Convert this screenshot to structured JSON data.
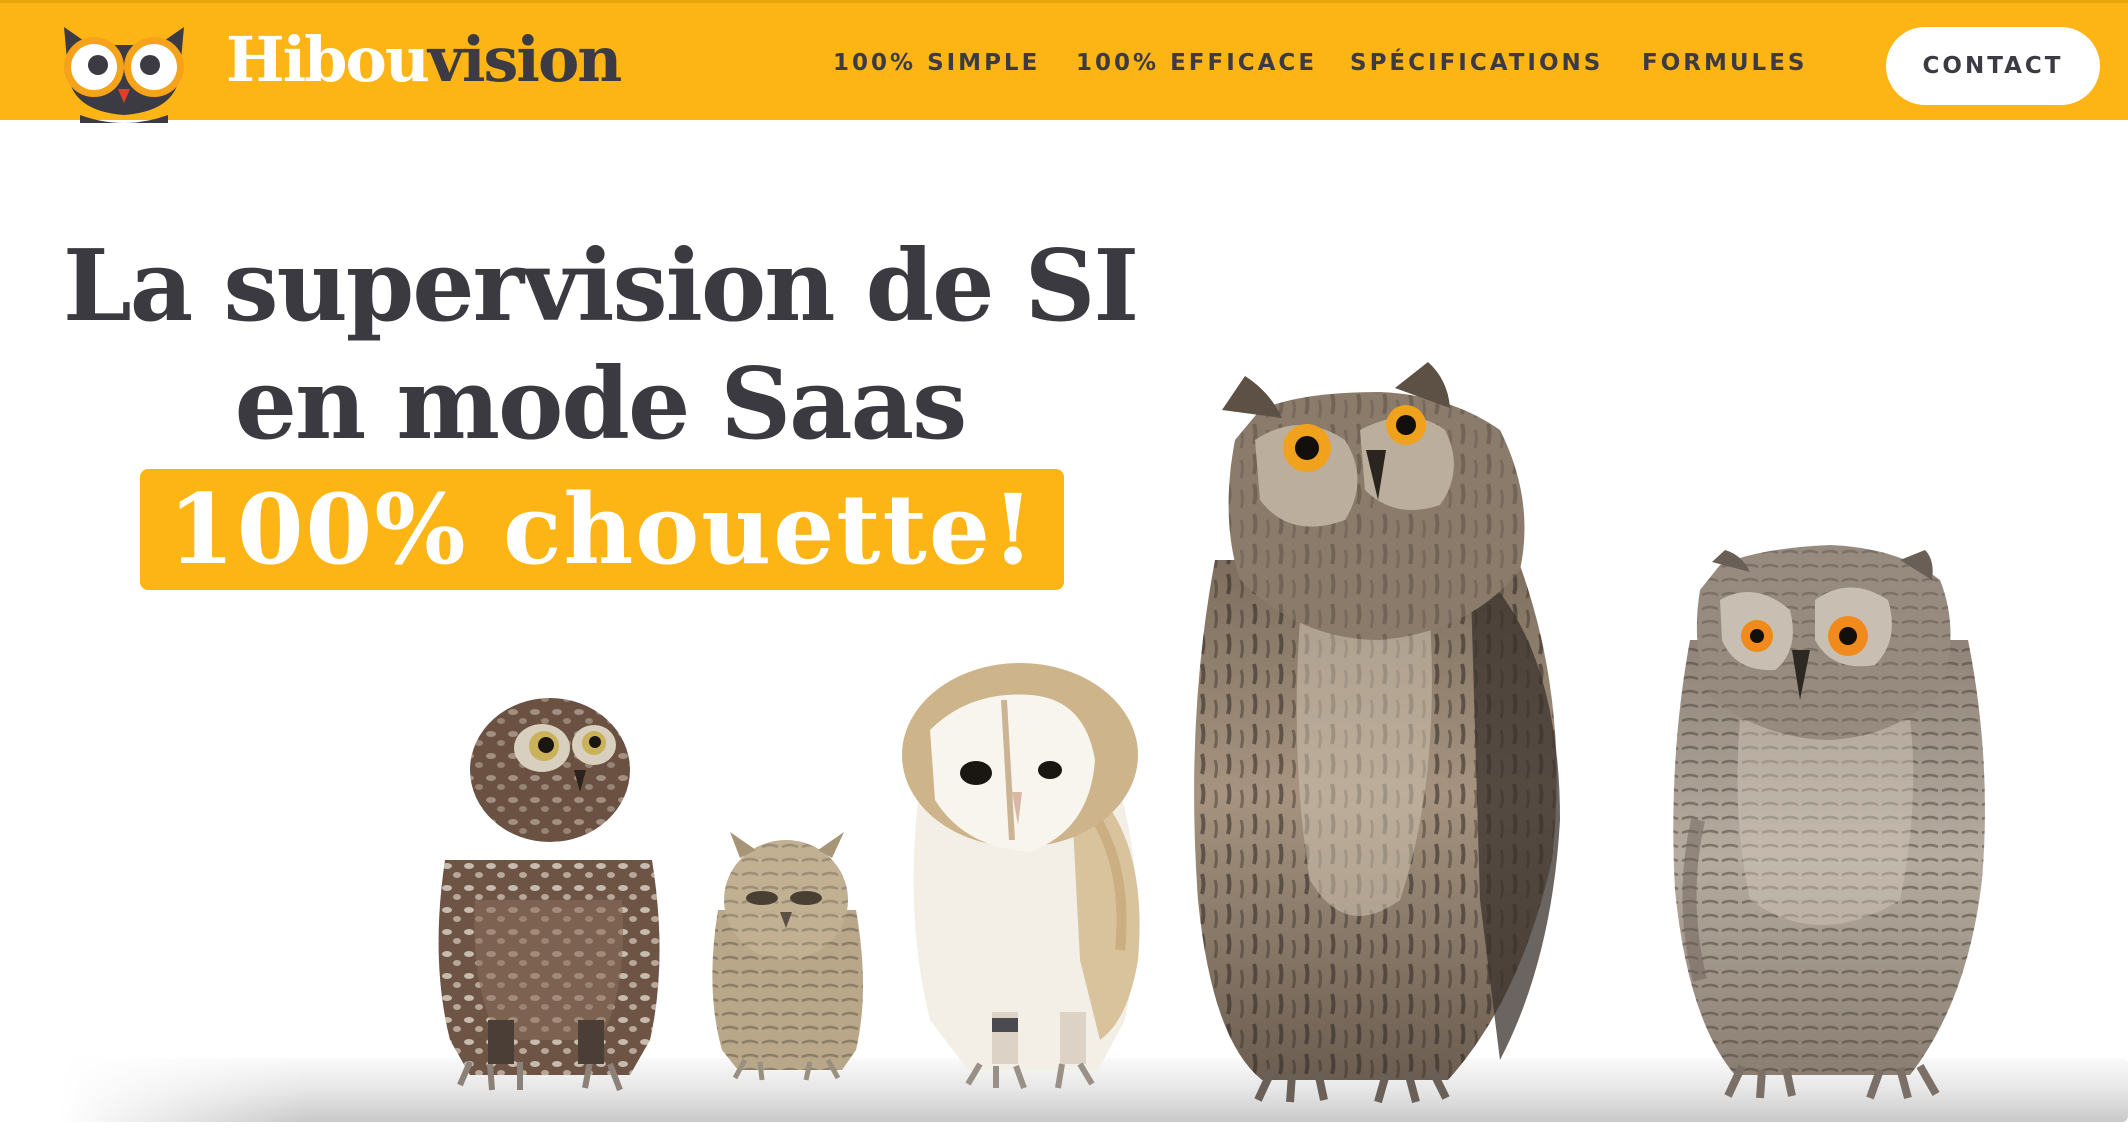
{
  "header": {
    "logo": {
      "text_part1": "Hibou",
      "text_part2": "vision",
      "icon": "owl-logo-icon"
    },
    "nav": [
      {
        "label": "100% SIMPLE"
      },
      {
        "label": "100% EFFICACE"
      },
      {
        "label": "SPÉCIFICATIONS"
      },
      {
        "label": "FORMULES"
      }
    ],
    "contact_label": "CONTACT"
  },
  "hero": {
    "title_line1": "La supervision de SI",
    "title_line2": "en mode Saas",
    "tagline": "100% chouette!"
  },
  "illustration": {
    "subject": "owls-on-perch"
  },
  "colors": {
    "brand": "#fdb515",
    "text": "#3a3a40",
    "white": "#ffffff"
  }
}
